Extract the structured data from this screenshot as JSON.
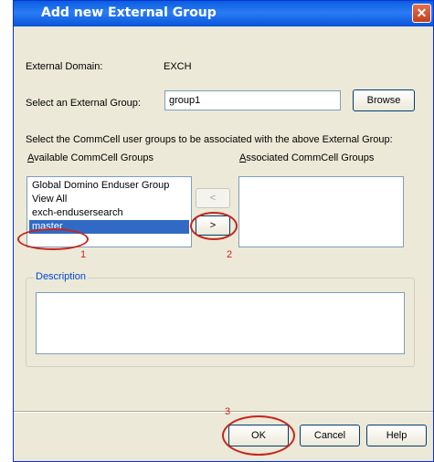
{
  "dialog": {
    "title": "Add new External Group",
    "close_icon": "close-icon (×)"
  },
  "form": {
    "domain_label": "External Domain:",
    "domain_value": "EXCH",
    "group_label": "Select an External Group:",
    "group_value": "group1",
    "browse_label": "Browse",
    "instruction": "Select the CommCell user groups to be associated with the above External Group:"
  },
  "available": {
    "label_first": "A",
    "label_rest": "vailable CommCell Groups",
    "items": [
      "Global Domino Enduser Group",
      "View All",
      "exch-endusersearch",
      "master"
    ],
    "selected_index": 3
  },
  "associated": {
    "label_first": "A",
    "label_rest": "ssociated CommCell Groups",
    "items": []
  },
  "transfer": {
    "remove_label": "<",
    "add_label": ">"
  },
  "description": {
    "legend": "Description",
    "value": ""
  },
  "buttons": {
    "ok": "OK",
    "cancel": "Cancel",
    "help": "Help"
  },
  "annotations": {
    "step1": "1",
    "step2": "2",
    "step3": "3",
    "color": "#c4261c"
  }
}
